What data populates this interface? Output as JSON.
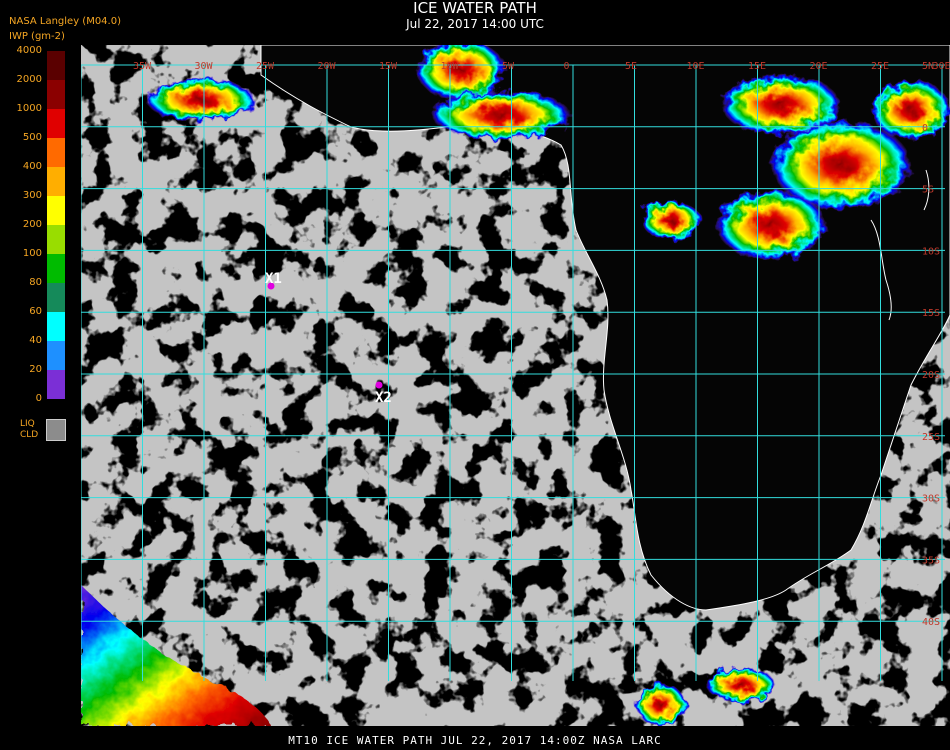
{
  "title": "ICE WATER PATH",
  "subtitle": "Jul 22, 2017 14:00 UTC",
  "producer": "NASA Langley (M04.0)",
  "units": "IWP (gm-2)",
  "legend": [
    {
      "label": "4000",
      "color": "#5a0000"
    },
    {
      "label": "2000",
      "color": "#8b0000"
    },
    {
      "label": "1000",
      "color": "#e00000"
    },
    {
      "label": "500",
      "color": "#ff6a00"
    },
    {
      "label": "400",
      "color": "#ffae00"
    },
    {
      "label": "300",
      "color": "#ffff00"
    },
    {
      "label": "200",
      "color": "#99dd00"
    },
    {
      "label": "100",
      "color": "#00bb00"
    },
    {
      "label": "80",
      "color": "#158a5a"
    },
    {
      "label": "60",
      "color": "#00ffff"
    },
    {
      "label": "40",
      "color": "#1e90ff"
    },
    {
      "label": "20",
      "color": "#0000ee"
    },
    {
      "label": "0",
      "color": "#7b2fd6"
    }
  ],
  "liquid_cloud": {
    "label_line1": "LIQ",
    "label_line2": "CLD",
    "color": "#8c8c8c"
  },
  "grid": {
    "longitude_labels": [
      "35W",
      "30W",
      "25W",
      "20W",
      "15W",
      "10W",
      "5W",
      "0",
      "5E",
      "10E",
      "15E",
      "20E",
      "25E",
      "30E",
      "35E"
    ],
    "latitude_labels": [
      "5N",
      "0",
      "5S",
      "10S",
      "15S",
      "20S",
      "25S",
      "30S",
      "35S",
      "40S"
    ],
    "line_color": "#33dddd"
  },
  "markers": [
    {
      "label": "X1",
      "color": "#e000e0"
    },
    {
      "label": "X2",
      "color": "#e000e0"
    }
  ],
  "footer": "MT10  ICE WATER PATH   JUL 22, 2017 14:00Z   NASA LARC"
}
